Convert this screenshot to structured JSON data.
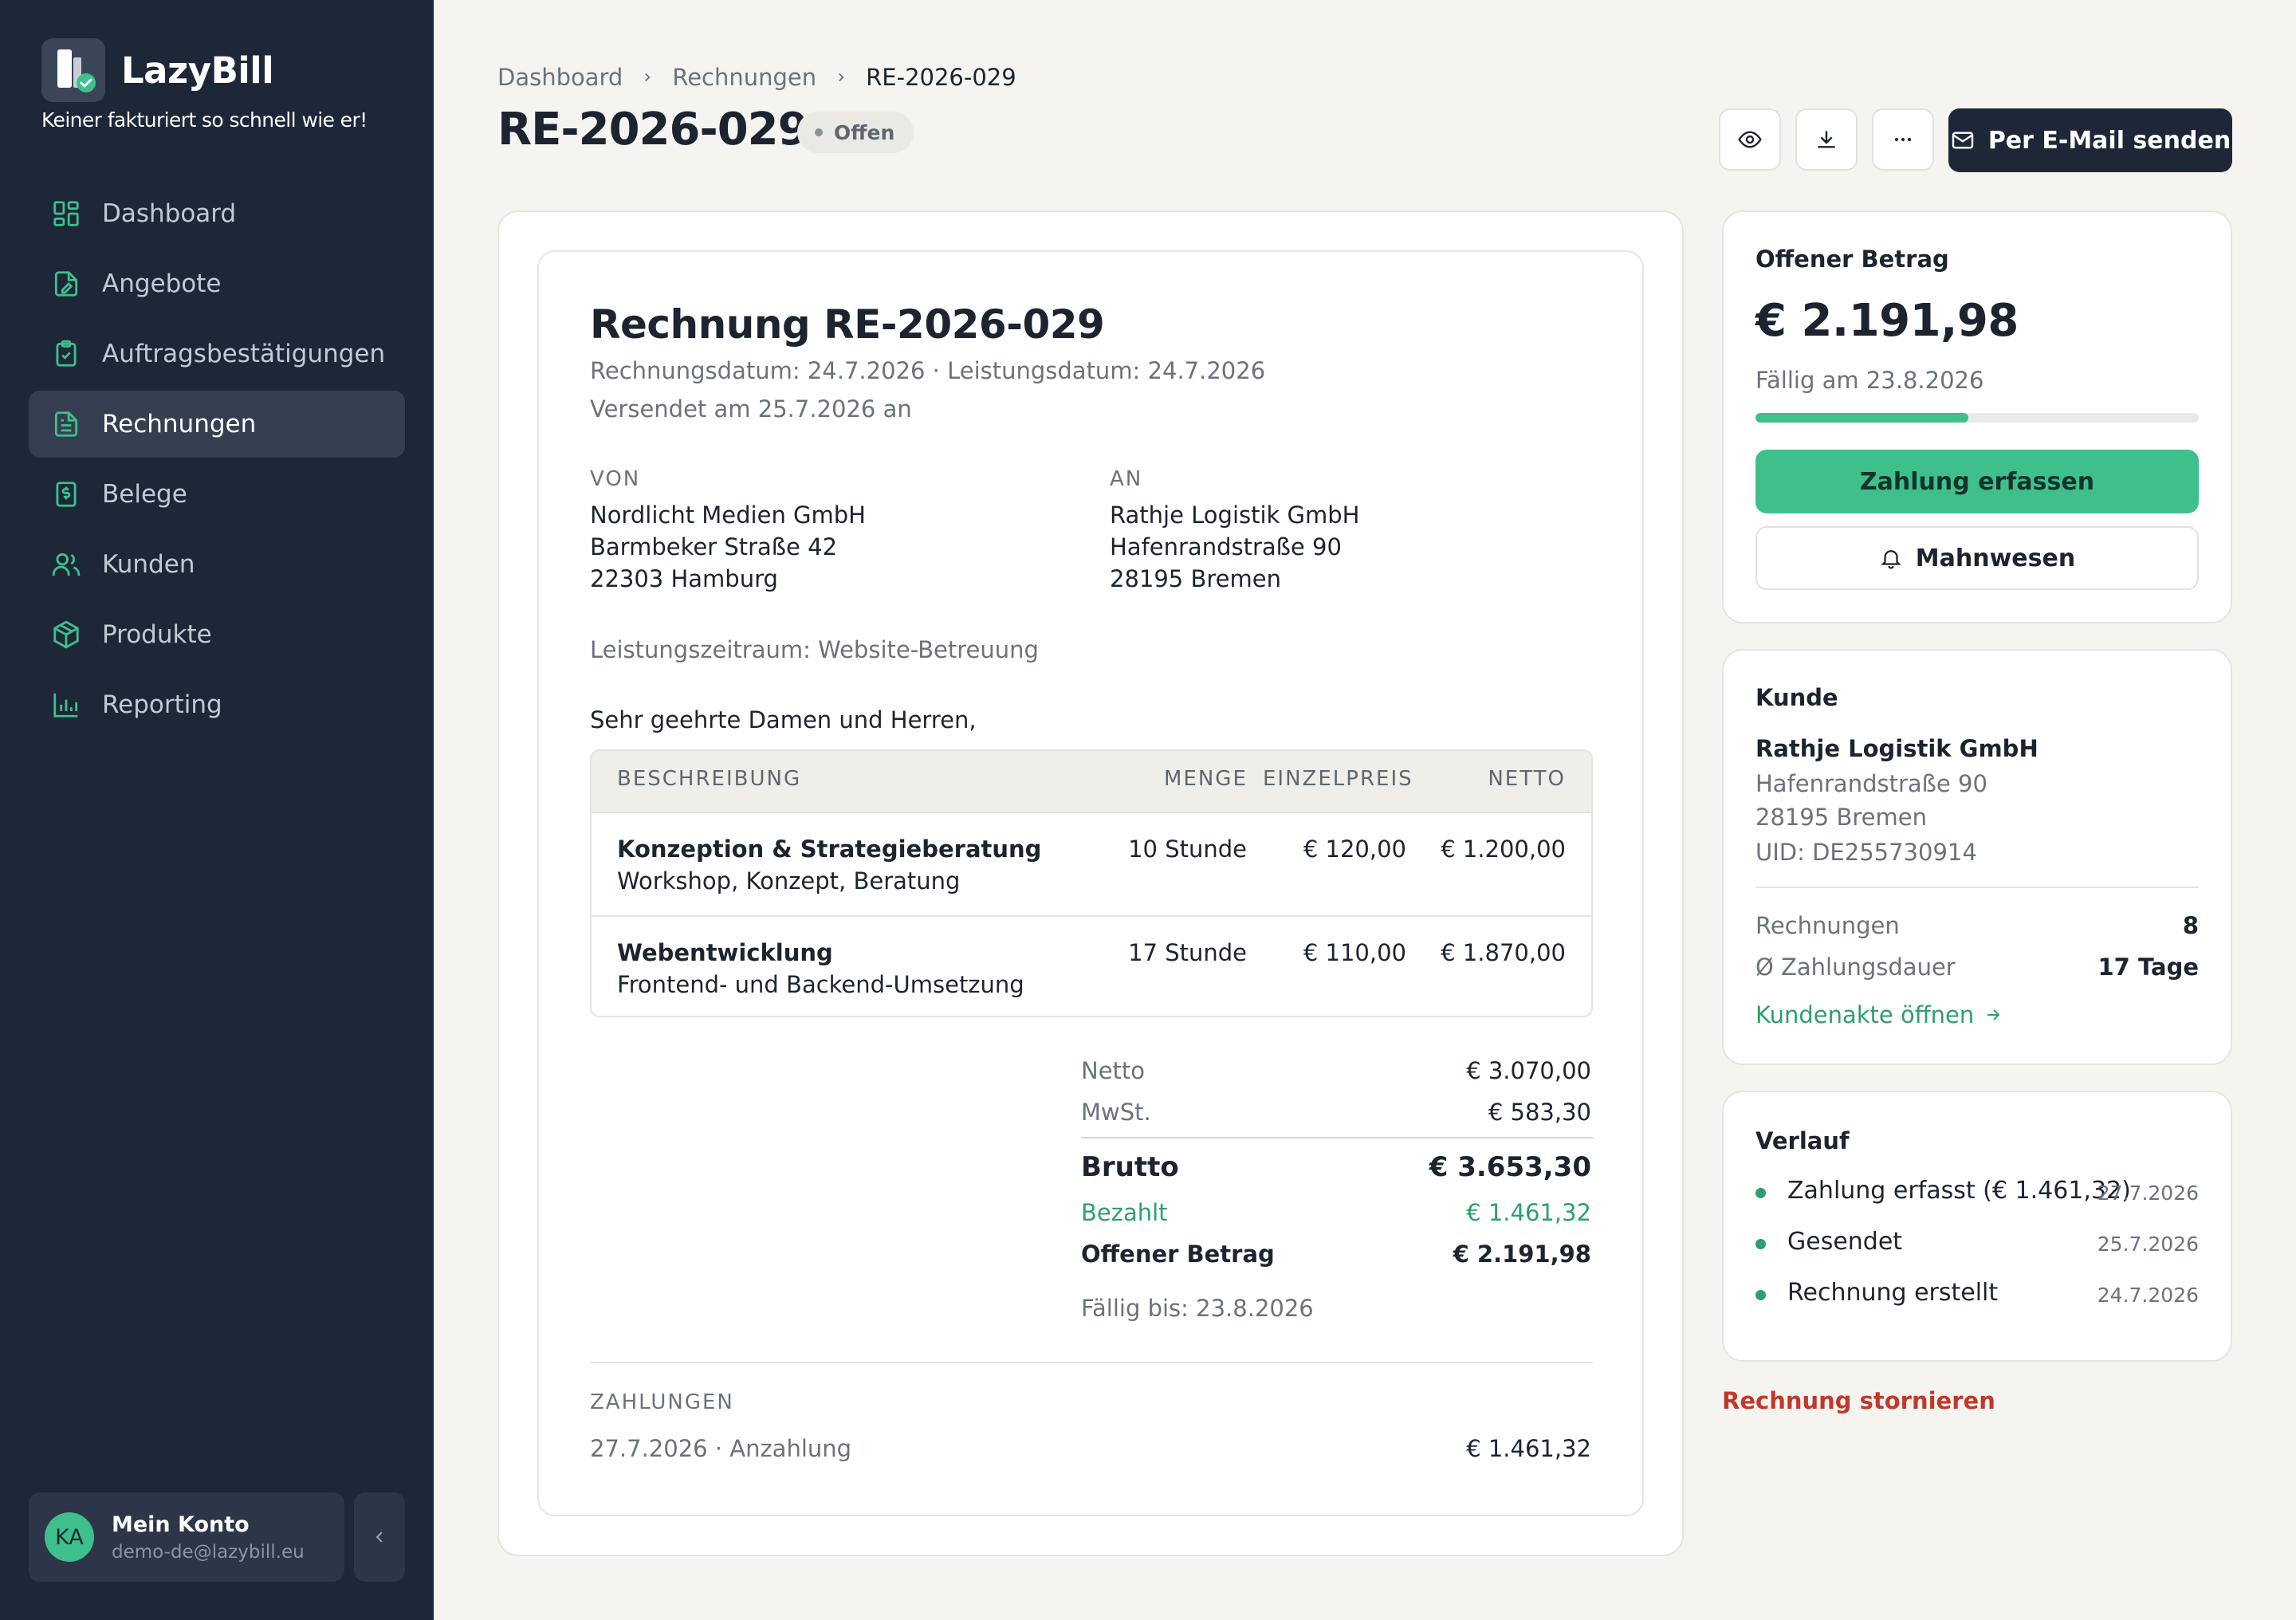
{
  "app": {
    "name": "LazyBill",
    "tagline": "Keiner fakturiert so schnell wie er!"
  },
  "nav": [
    {
      "label": "Dashboard",
      "icon": "dashboard-icon",
      "active": false
    },
    {
      "label": "Angebote",
      "icon": "quote-file-icon",
      "active": false
    },
    {
      "label": "Auftragsbestätigungen",
      "icon": "clipboard-check-icon",
      "active": false
    },
    {
      "label": "Rechnungen",
      "icon": "invoice-file-icon",
      "active": true
    },
    {
      "label": "Belege",
      "icon": "receipt-icon",
      "active": false
    },
    {
      "label": "Kunden",
      "icon": "users-icon",
      "active": false
    },
    {
      "label": "Produkte",
      "icon": "box-icon",
      "active": false
    },
    {
      "label": "Reporting",
      "icon": "bar-chart-icon",
      "active": false
    }
  ],
  "account": {
    "initials": "KA",
    "name": "Mein Konto",
    "email": "demo-de@lazybill.eu"
  },
  "breadcrumb": [
    "Dashboard",
    "Rechnungen",
    "RE-2026-029"
  ],
  "page": {
    "title": "RE-2026-029",
    "status": "Offen"
  },
  "toolbar": {
    "send_email_label": "Per E-Mail senden"
  },
  "invoice": {
    "title": "Rechnung RE-2026-029",
    "dates_line": "Rechnungsdatum: 24.7.2026 · Leistungsdatum: 24.7.2026",
    "sent_line": "Versendet am 25.7.2026 an",
    "from_label": "VON",
    "from": [
      "Nordlicht Medien GmbH",
      "Barmbeker Straße 42",
      "22303 Hamburg"
    ],
    "to_label": "AN",
    "to": [
      "Rathje Logistik GmbH",
      "Hafenrandstraße 90",
      "28195 Bremen"
    ],
    "period": "Leistungszeitraum: Website-Betreuung",
    "greeting": "Sehr geehrte Damen und Herren,",
    "columns": {
      "description": "BESCHREIBUNG",
      "quantity": "MENGE",
      "unit_price": "EINZELPREIS",
      "net": "NETTO"
    },
    "items": [
      {
        "title": "Konzeption & Strategieberatung",
        "subtitle": "Workshop, Konzept, Beratung",
        "quantity": "10 Stunde",
        "unit_price": "€ 120,00",
        "net": "€ 1.200,00"
      },
      {
        "title": "Webentwicklung",
        "subtitle": "Frontend- und Backend-Umsetzung",
        "quantity": "17 Stunde",
        "unit_price": "€ 110,00",
        "net": "€ 1.870,00"
      }
    ],
    "totals": {
      "net_label": "Netto",
      "net": "€ 3.070,00",
      "vat_label": "MwSt.",
      "vat": "€ 583,30",
      "gross_label": "Brutto",
      "gross": "€ 3.653,30",
      "paid_label": "Bezahlt",
      "paid": "€ 1.461,32",
      "open_label": "Offener Betrag",
      "open": "€ 2.191,98",
      "due_line": "Fällig bis: 23.8.2026"
    },
    "payments_label": "ZAHLUNGEN",
    "payments": [
      {
        "label": "27.7.2026 · Anzahlung",
        "amount": "€ 1.461,32"
      }
    ]
  },
  "open_amount_panel": {
    "title": "Offener Betrag",
    "amount": "€ 2.191,98",
    "due": "Fällig am 23.8.2026",
    "paid_fraction": 0.48,
    "record_payment_label": "Zahlung erfassen",
    "dunning_label": "Mahnwesen"
  },
  "customer_panel": {
    "title": "Kunde",
    "name": "Rathje Logistik GmbH",
    "street": "Hafenrandstraße 90",
    "city": "28195 Bremen",
    "vat_id": "UID: DE255730914",
    "invoices_label": "Rechnungen",
    "invoices_count": "8",
    "payment_duration_label": "Ø Zahlungsdauer",
    "payment_duration": "17 Tage",
    "open_file_label": "Kundenakte öffnen"
  },
  "history_panel": {
    "title": "Verlauf",
    "items": [
      {
        "label": "Zahlung erfasst (€ 1.461,32)",
        "date": "27.7.2026"
      },
      {
        "label": "Gesendet",
        "date": "25.7.2026"
      },
      {
        "label": "Rechnung erstellt",
        "date": "24.7.2026"
      }
    ]
  },
  "cancel_label": "Rechnung stornieren",
  "colors": {
    "sidebar": "#1d2738",
    "accent": "#3fbf8b",
    "danger": "#c0392b",
    "background": "#f5f4f1"
  }
}
